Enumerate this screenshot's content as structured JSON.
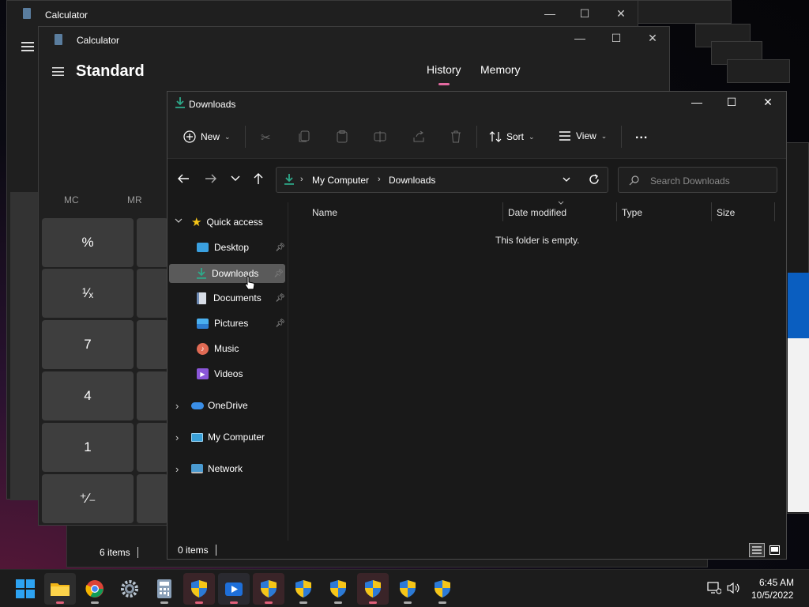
{
  "background_windows": {
    "calc_back_title": "Calculator",
    "calc_back_status": "6 i"
  },
  "calculator": {
    "title": "Calculator",
    "mode": "Standard",
    "tabs": [
      "History",
      "Memory"
    ],
    "memory_buttons": [
      "MC",
      "MR"
    ],
    "keys": [
      "%",
      "¹⁄ₓ",
      "7",
      "4",
      "1",
      "⁺∕₋"
    ],
    "status": "6 items"
  },
  "explorer": {
    "title": "Downloads",
    "commands": {
      "new": "New",
      "sort": "Sort",
      "view": "View",
      "more": "..."
    },
    "address": {
      "segments": [
        "My Computer",
        "Downloads"
      ]
    },
    "search": {
      "placeholder": "Search Downloads"
    },
    "nav": {
      "quick_access": "Quick access",
      "items": [
        "Desktop",
        "Downloads",
        "Documents",
        "Pictures",
        "Music",
        "Videos"
      ],
      "onedrive": "OneDrive",
      "my_computer": "My Computer",
      "network": "Network"
    },
    "columns": [
      "Name",
      "Date modified",
      "Type",
      "Size"
    ],
    "empty_message": "This folder is empty.",
    "status": "0 items"
  },
  "taskbar": {
    "time": "6:45 AM",
    "date": "10/5/2022",
    "apps": [
      "start-icon",
      "file-explorer-icon",
      "chrome-icon",
      "settings-icon",
      "calculator-icon",
      "uac-shield-icon",
      "media-player-icon",
      "uac-shield-icon",
      "uac-shield-icon",
      "uac-shield-icon",
      "uac-shield-icon",
      "uac-shield-icon",
      "uac-shield-icon"
    ]
  },
  "colors": {
    "accent": "#4cc2ff",
    "selected_nav": "#5a5a5a",
    "download_green": "#2ea98a",
    "window_bg": "#191919"
  }
}
